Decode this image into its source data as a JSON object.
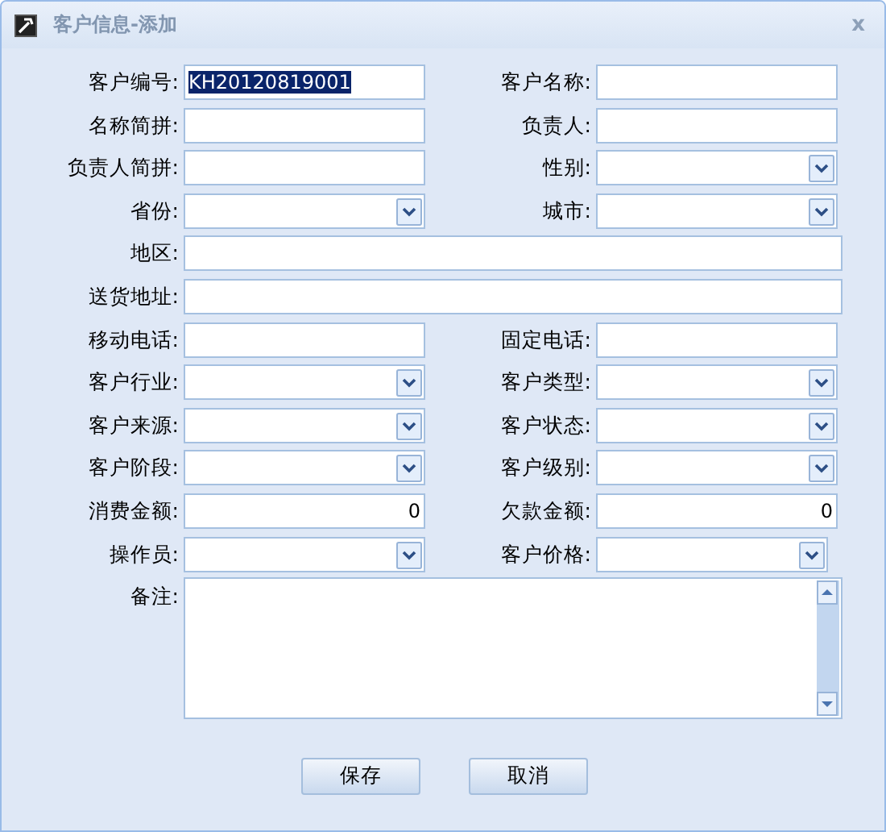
{
  "window": {
    "title": "客户信息-添加",
    "close": "x"
  },
  "rows": [
    [
      {
        "label": "客户编号:",
        "kind": "text",
        "value": "KH20120819001",
        "highlighted": true
      },
      {
        "label": "客户名称:",
        "kind": "text"
      }
    ],
    [
      {
        "label": "名称简拼:",
        "kind": "text"
      },
      {
        "label": "负责人:",
        "kind": "text"
      }
    ],
    [
      {
        "label": "负责人简拼:",
        "kind": "text"
      },
      {
        "label": "性别:",
        "kind": "select"
      }
    ],
    [
      {
        "label": "省份:",
        "kind": "select"
      },
      {
        "label": "城市:",
        "kind": "select"
      }
    ],
    [
      {
        "label": "地区:",
        "kind": "wide"
      }
    ],
    [
      {
        "label": "送货地址:",
        "kind": "wide"
      }
    ],
    [
      {
        "label": "移动电话:",
        "kind": "text"
      },
      {
        "label": "固定电话:",
        "kind": "text"
      }
    ],
    [
      {
        "label": "客户行业:",
        "kind": "select"
      },
      {
        "label": "客户类型:",
        "kind": "select"
      }
    ],
    [
      {
        "label": "客户来源:",
        "kind": "select"
      },
      {
        "label": "客户状态:",
        "kind": "select"
      }
    ],
    [
      {
        "label": "客户阶段:",
        "kind": "select"
      },
      {
        "label": "客户级别:",
        "kind": "select"
      }
    ],
    [
      {
        "label": "消费金额:",
        "kind": "number",
        "value": "0"
      },
      {
        "label": "欠款金额:",
        "kind": "number",
        "value": "0"
      }
    ],
    [
      {
        "label": "操作员:",
        "kind": "select"
      },
      {
        "label": "客户价格:",
        "kind": "narrow-select"
      }
    ]
  ],
  "notes": {
    "label": "备注:"
  },
  "buttons": [
    "保存",
    "取消"
  ]
}
